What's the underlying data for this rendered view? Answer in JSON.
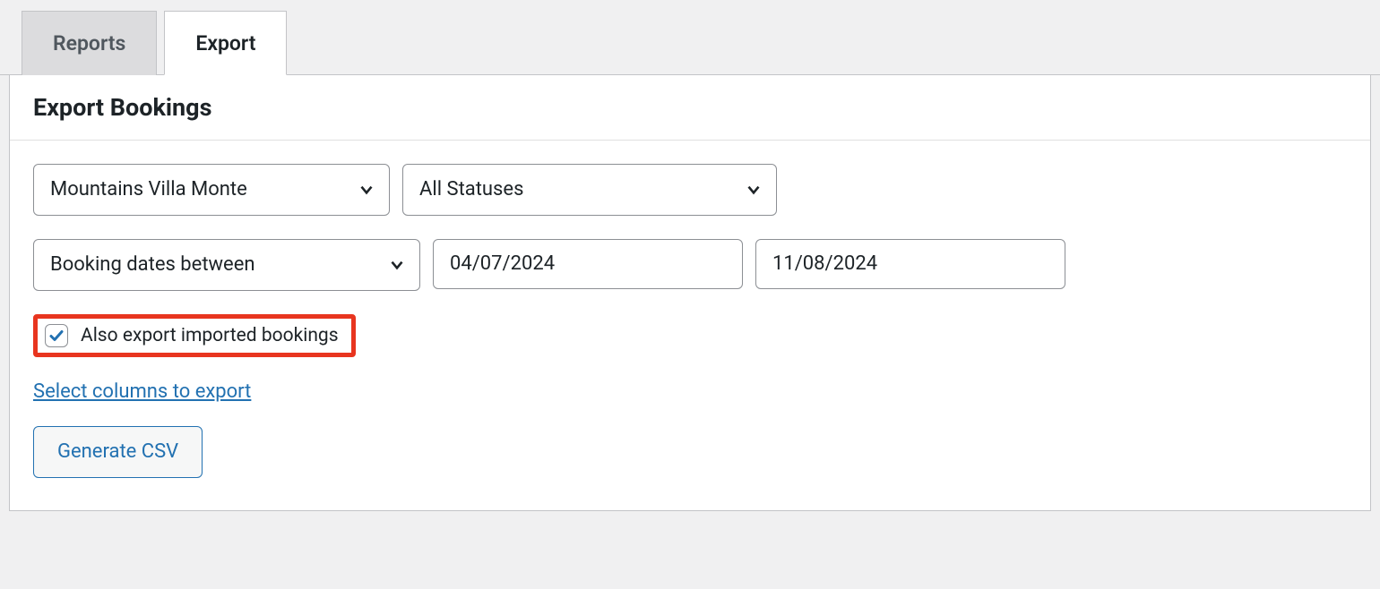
{
  "tabs": {
    "reports": "Reports",
    "export": "Export"
  },
  "panel": {
    "title": "Export Bookings"
  },
  "filters": {
    "product": "Mountains Villa Monte",
    "status": "All Statuses",
    "date_mode": "Booking dates between",
    "date_from": "04/07/2024",
    "date_to": "11/08/2024"
  },
  "options": {
    "also_export_imported_label": "Also export imported bookings",
    "also_export_imported_checked": true
  },
  "links": {
    "select_columns": "Select columns to export"
  },
  "buttons": {
    "generate_csv": "Generate CSV"
  }
}
